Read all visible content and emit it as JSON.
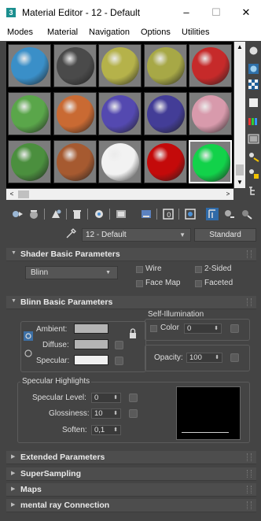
{
  "window": {
    "app_icon_text": "3",
    "title": "Material Editor - 12 - Default",
    "minimize": "–",
    "maximize": "☐",
    "close": "✕"
  },
  "menu": [
    "Modes",
    "Material",
    "Navigation",
    "Options",
    "Utilities"
  ],
  "slots": [
    {
      "color": "#3a8fc8"
    },
    {
      "color": "#4a4a4a"
    },
    {
      "color": "#b5b24a"
    },
    {
      "color": "#a7a846"
    },
    {
      "color": "#c62a2a"
    },
    {
      "color": "#5aa64a"
    },
    {
      "color": "#c96a33"
    },
    {
      "color": "#5449b0"
    },
    {
      "color": "#433d97"
    },
    {
      "color": "#d89aac"
    },
    {
      "color": "#4b8f3e"
    },
    {
      "color": "#a65a30"
    },
    {
      "color": "#f2f2f2"
    },
    {
      "color": "#c40a0a"
    },
    {
      "color": "#12d24a"
    }
  ],
  "active_slot_index": 14,
  "scroll": {
    "left_arrow": "<",
    "right_arrow": ">",
    "up_arrow": "▲",
    "down_arrow": "▼"
  },
  "material": {
    "name": "12 - Default",
    "type": "Standard"
  },
  "rollouts": {
    "shader": {
      "title": "Shader Basic Parameters",
      "shader_type": "Blinn",
      "wire": "Wire",
      "two_sided": "2-Sided",
      "face_map": "Face Map",
      "faceted": "Faceted"
    },
    "blinn": {
      "title": "Blinn Basic Parameters",
      "self_illum_title": "Self-Illumination",
      "color_label": "Color",
      "color_value": "0",
      "ambient": "Ambient:",
      "diffuse": "Diffuse:",
      "specular": "Specular:",
      "opacity_label": "Opacity:",
      "opacity_value": "100",
      "highlights_title": "Specular Highlights",
      "spec_level_label": "Specular Level:",
      "spec_level_value": "0",
      "glossiness_label": "Glossiness:",
      "glossiness_value": "10",
      "soften_label": "Soften:",
      "soften_value": "0,1"
    },
    "collapsed": [
      "Extended Parameters",
      "SuperSampling",
      "Maps",
      "mental ray Connection"
    ]
  },
  "colors": {
    "ambient_swatch": "#b4b4b4",
    "diffuse_swatch": "#b4b4b4",
    "specular_swatch": "#f0f0f0"
  }
}
